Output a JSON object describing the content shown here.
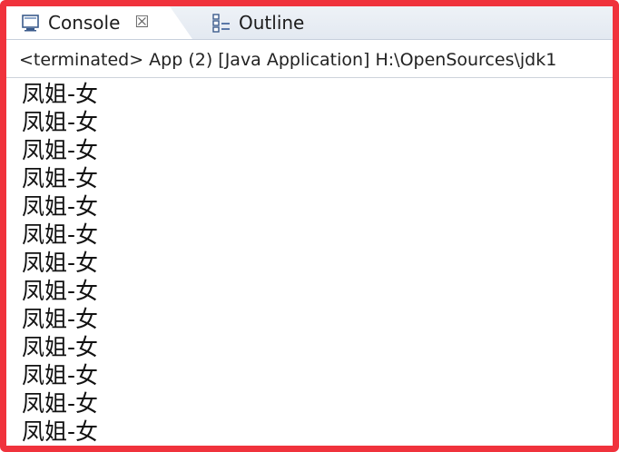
{
  "tabs": [
    {
      "label": "Console",
      "icon": "console-icon",
      "close_glyph": "☒"
    },
    {
      "label": "Outline",
      "icon": "outline-icon"
    }
  ],
  "status_line": "<terminated> App (2) [Java Application] H:\\OpenSources\\jdk1",
  "output_lines": [
    "凤姐-女",
    "凤姐-女",
    "凤姐-女",
    "凤姐-女",
    "凤姐-女",
    "凤姐-女",
    "凤姐-女",
    "凤姐-女",
    "凤姐-女",
    "凤姐-女",
    "凤姐-女",
    "凤姐-女",
    "凤姐-女"
  ],
  "colors": {
    "frame_border": "#f0323c",
    "tab_bar_bg": "#e3e9f1"
  }
}
